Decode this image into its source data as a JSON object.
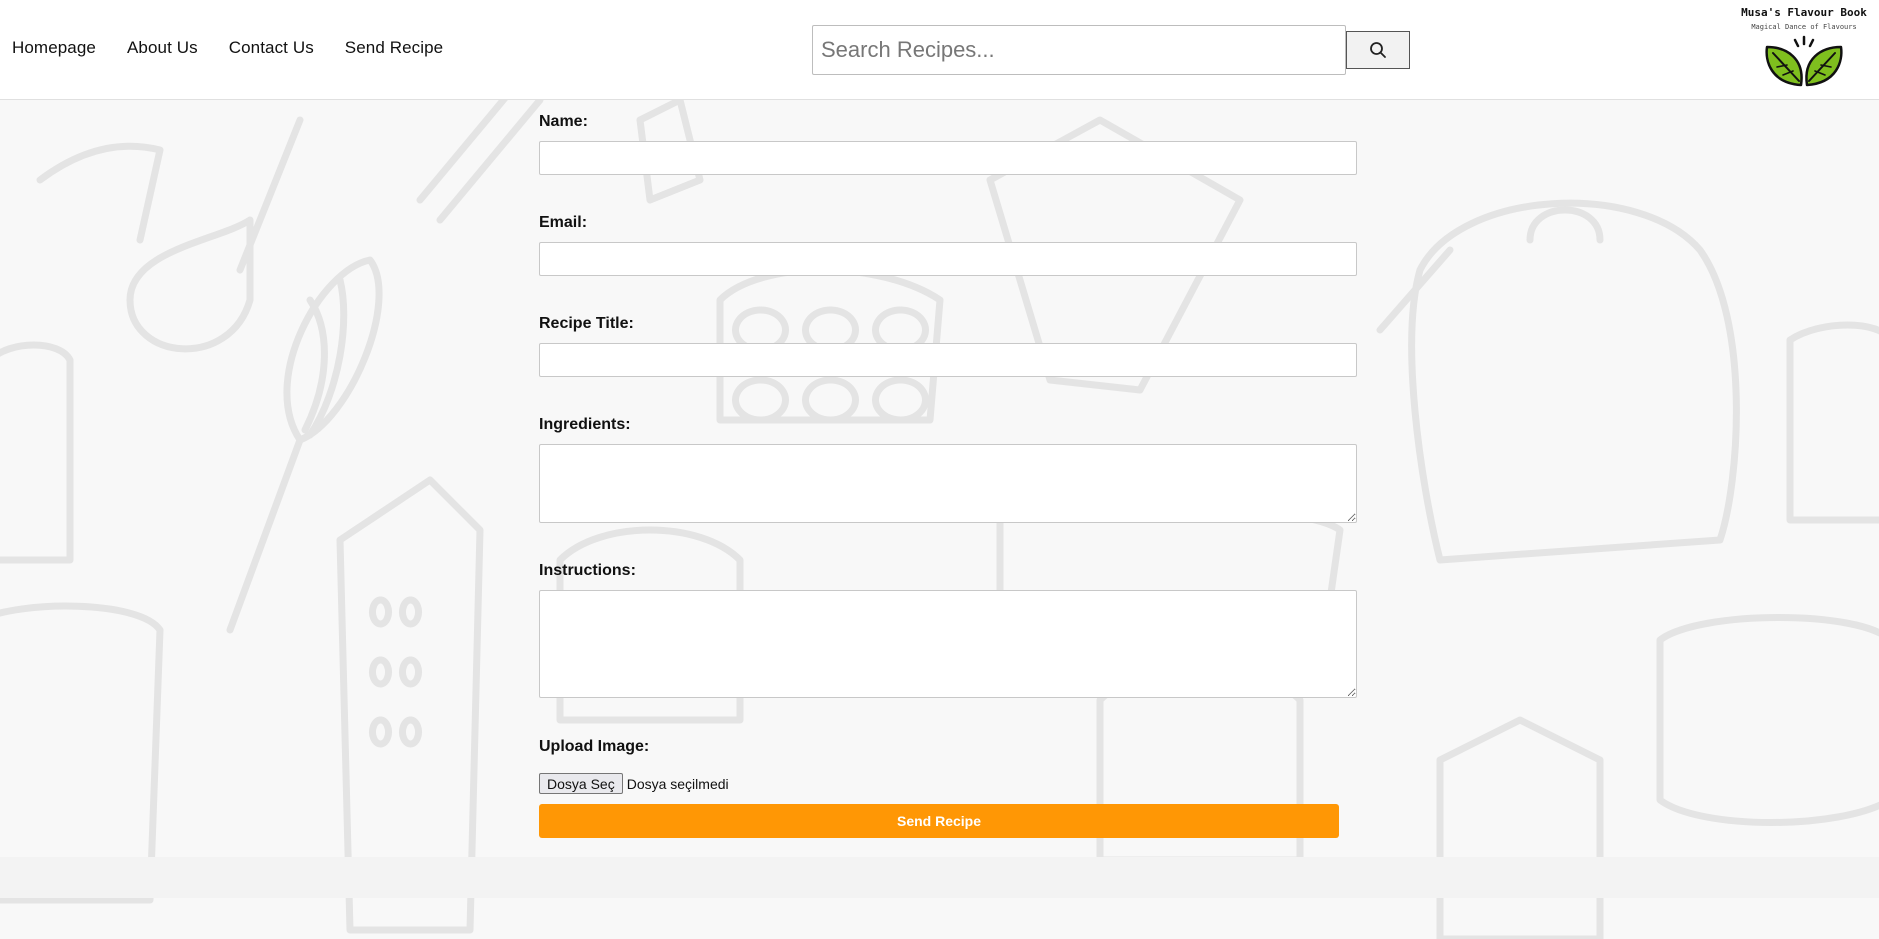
{
  "nav": {
    "items": [
      {
        "label": "Homepage"
      },
      {
        "label": "About Us"
      },
      {
        "label": "Contact Us"
      },
      {
        "label": "Send Recipe"
      }
    ]
  },
  "search": {
    "placeholder": "Search Recipes...",
    "value": "",
    "button_icon": "search-icon"
  },
  "brand": {
    "title": "Musa's Flavour Book",
    "subtitle": "Magical Dance of Flavours",
    "logo_icon": "leaves-bowl-icon"
  },
  "form": {
    "name_label": "Name:",
    "name_value": "",
    "email_label": "Email:",
    "email_value": "",
    "title_label": "Recipe Title:",
    "title_value": "",
    "ingredients_label": "Ingredients:",
    "ingredients_value": "",
    "instructions_label": "Instructions:",
    "instructions_value": "",
    "upload_label": "Upload Image:",
    "file_button": "Dosya Seç",
    "file_status": "Dosya seçilmedi",
    "submit_label": "Send Recipe"
  },
  "colors": {
    "accent": "#ff9705",
    "logo_green": "#7fbf1e",
    "background_doodle": "#e6e6e6"
  }
}
